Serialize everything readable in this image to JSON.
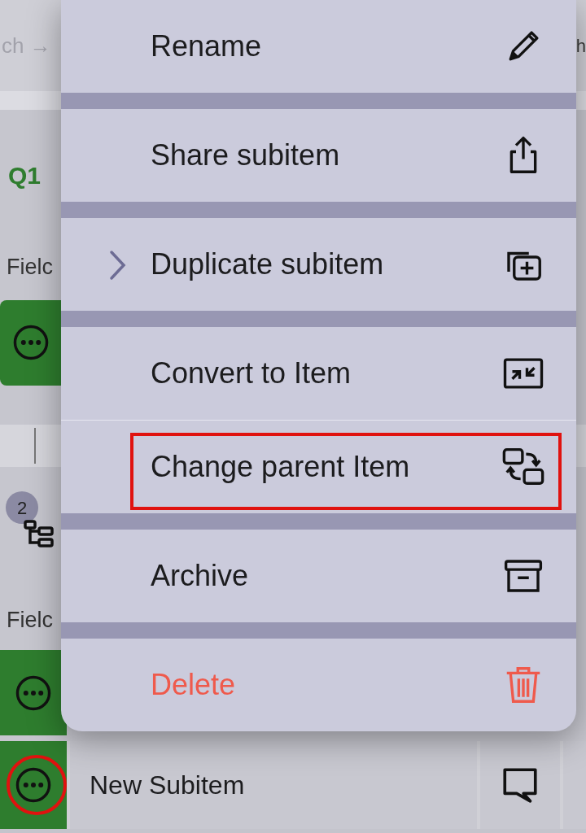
{
  "background": {
    "breadcrumb": "ch →",
    "header_cut": "h",
    "group_title": "Q1",
    "field_labels": [
      "Fielc",
      "Fielc"
    ],
    "subitem_badge": "2",
    "new_subitem": {
      "label": "New Subitem",
      "circled": true
    }
  },
  "menu": {
    "items": [
      {
        "label": "Rename",
        "kind": "normal",
        "break_after": true,
        "highlighted": false
      },
      {
        "label": "Share subitem",
        "kind": "normal",
        "break_after": true,
        "highlighted": false
      },
      {
        "label": "Duplicate subitem",
        "kind": "submenu",
        "break_after": true,
        "highlighted": false
      },
      {
        "label": "Convert to Item",
        "kind": "normal",
        "break_after": false,
        "highlighted": false
      },
      {
        "label": "Change parent Item",
        "kind": "normal",
        "break_after": true,
        "highlighted": true
      },
      {
        "label": "Archive",
        "kind": "normal",
        "break_after": true,
        "highlighted": false
      },
      {
        "label": "Delete",
        "kind": "destructive",
        "highlighted": false
      }
    ]
  }
}
